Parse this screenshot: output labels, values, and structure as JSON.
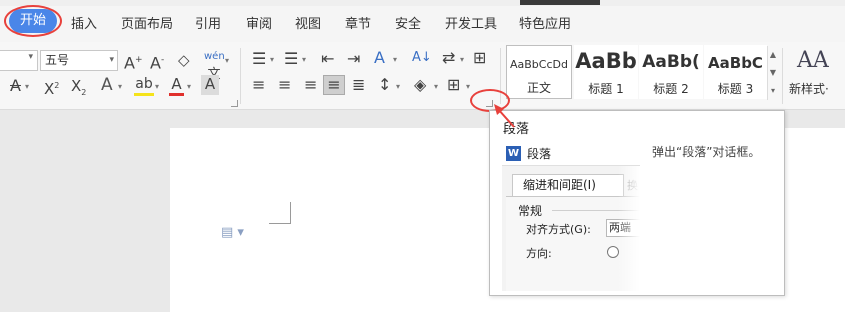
{
  "menu": {
    "active": "开始",
    "items": [
      "插入",
      "页面布局",
      "引用",
      "审阅",
      "视图",
      "章节",
      "安全",
      "开发工具",
      "特色应用"
    ]
  },
  "ribbon": {
    "font_size_value": "五号",
    "styles": [
      {
        "sample": "AaBbCcDd",
        "name": "正文"
      },
      {
        "sample": "AaBb",
        "name": "标题 1"
      },
      {
        "sample": "AaBb(",
        "name": "标题 2"
      },
      {
        "sample": "AaBbC",
        "name": "标题 3"
      }
    ],
    "new_style_label": "新样式·"
  },
  "tooltip": {
    "title": "段落",
    "description": "弹出“段落”对话框。",
    "preview": {
      "dialog_title": "段落",
      "logo": "W",
      "tab_active": "缩进和间距(I)",
      "group_label": "常规",
      "align_label": "对齐方式(G):",
      "align_value": "两端",
      "direction_label": "方向:"
    }
  },
  "colors": {
    "accent": "#4a86e8",
    "annotation": "#e8413c",
    "highlight_yellow": "#f5e31b",
    "font_red": "#e0302c",
    "word_blue": "#2b5fb4"
  },
  "icons": [
    "bold-icon",
    "italic-icon",
    "underline-icon",
    "font-grow-icon",
    "font-shrink-icon",
    "clear-format-icon",
    "phonetic-icon",
    "strikethrough-icon",
    "superscript-icon",
    "subscript-icon",
    "text-effect-icon",
    "highlight-icon",
    "font-color-icon",
    "char-shading-icon",
    "bullets-icon",
    "numbering-icon",
    "decrease-indent-icon",
    "increase-indent-icon",
    "chinese-layout-icon",
    "sort-icon",
    "show-marks-icon",
    "table-icon",
    "align-left-icon",
    "align-center-icon",
    "align-right-icon",
    "justify-icon",
    "distributed-icon",
    "line-spacing-icon",
    "shading-icon",
    "border-icon",
    "paragraph-launcher-icon",
    "new-style-icon",
    "document-icon"
  ]
}
